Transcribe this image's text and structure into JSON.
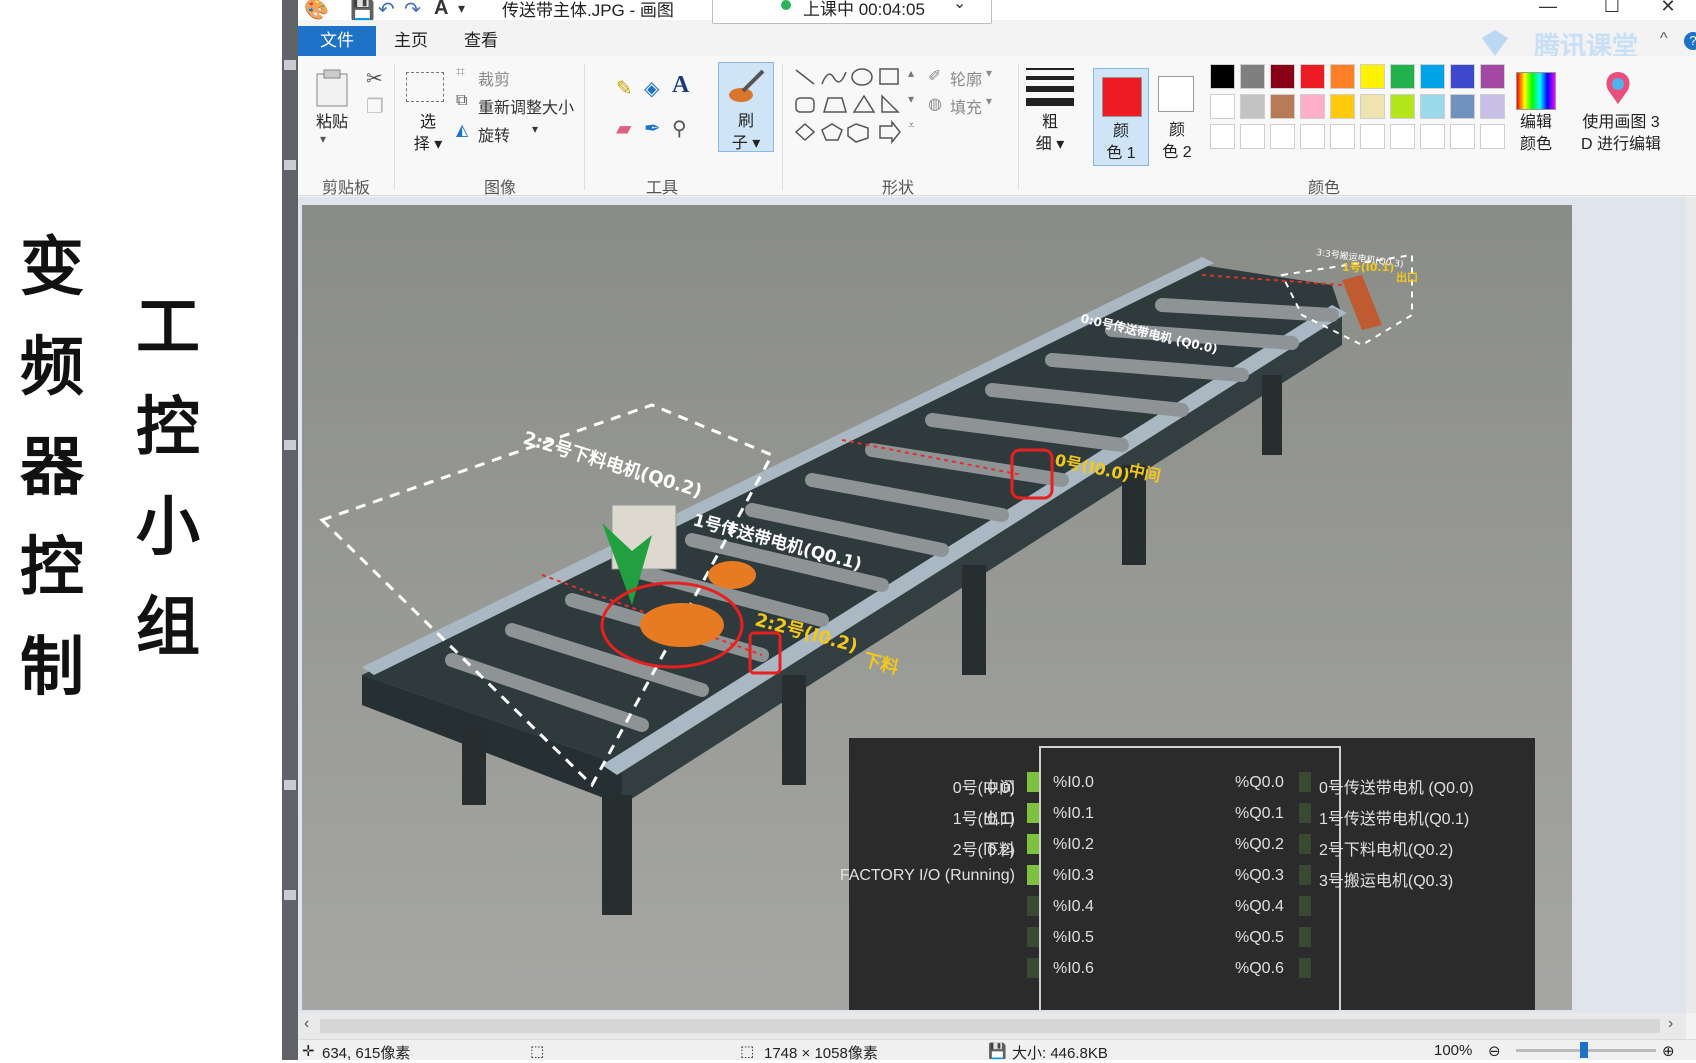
{
  "overlay": {
    "col1": [
      "变",
      "频",
      "器",
      "控",
      "制"
    ],
    "col2": [
      "工",
      "控",
      "小",
      "组"
    ]
  },
  "titlebar": {
    "title": "传送带主体.JPG - 画图",
    "live_status": "上课中 00:04:05",
    "min": "—",
    "max": "☐",
    "close": "✕"
  },
  "menu": {
    "file": "文件",
    "home": "主页",
    "view": "查看",
    "watermark": "腾讯课堂"
  },
  "ribbon": {
    "clipboard": {
      "paste": "粘贴",
      "group": "剪贴板"
    },
    "image": {
      "select_1": "选",
      "select_2": "择",
      "crop": "裁剪",
      "resize": "重新调整大小",
      "rotate": "旋转",
      "group": "图像"
    },
    "tools": {
      "brush_1": "刷",
      "brush_2": "子",
      "group": "工具"
    },
    "shapes": {
      "outline": "轮廓",
      "fill": "填充",
      "group": "形状"
    },
    "size": {
      "label_1": "粗",
      "label_2": "细"
    },
    "color1": {
      "label_1": "颜",
      "label_2": "色 1"
    },
    "color2": {
      "label_1": "颜",
      "label_2": "色 2"
    },
    "colors_group": "颜色",
    "edit_colors_1": "编辑",
    "edit_colors_2": "颜色",
    "paint3d_1": "使用画图 3",
    "paint3d_2": "D 进行编辑",
    "palette_row1": [
      "#000000",
      "#7f7f7f",
      "#880015",
      "#ed1c24",
      "#ff7f27",
      "#fff200",
      "#22b14c",
      "#00a2e8",
      "#3f48cc",
      "#a349a4"
    ],
    "palette_row2": [
      "#ffffff",
      "#c3c3c3",
      "#b97a57",
      "#ffaec9",
      "#ffc90e",
      "#efe4b0",
      "#b5e61d",
      "#99d9ea",
      "#7092be",
      "#c8bfe7"
    ]
  },
  "scene": {
    "label_motor0": "0:0号传送带电机 (Q0.0)",
    "label_motor1": "1号传送带电机(Q0.1)",
    "label_motor2": "2:2号下料电机(Q0.2)",
    "label_motor3": "3:3号搬运电机(Q0.3)",
    "label_sensor0": "0号(I0.0)",
    "label_sensor0_pos": "中间",
    "label_sensor1": "1号(I0.1)",
    "label_sensor1_pos": "出口",
    "label_sensor2": "2:2号(I0.2)",
    "label_sensor2_pos": "下料"
  },
  "io_panel": {
    "left_labels": [
      {
        "name": "0号(I0.0)",
        "pos": "中间"
      },
      {
        "name": "1号(I0.1)",
        "pos": "出口"
      },
      {
        "name": "2号(I0.2)",
        "pos": "下料"
      },
      {
        "name": "FACTORY I/O (Running)",
        "pos": ""
      }
    ],
    "inputs": [
      "%I0.0",
      "%I0.1",
      "%I0.2",
      "%I0.3",
      "%I0.4",
      "%I0.5",
      "%I0.6"
    ],
    "outputs": [
      "%Q0.0",
      "%Q0.1",
      "%Q0.2",
      "%Q0.3",
      "%Q0.4",
      "%Q0.5",
      "%Q0.6"
    ],
    "output_labels": [
      "0号传送带电机 (Q0.0)",
      "1号传送带电机(Q0.1)",
      "2号下料电机(Q0.2)",
      "3号搬运电机(Q0.3)"
    ]
  },
  "statusbar": {
    "cursor": "634, 615像素",
    "dimensions": "1748 × 1058像素",
    "size": "大小: 446.8KB",
    "zoom": "100%"
  }
}
